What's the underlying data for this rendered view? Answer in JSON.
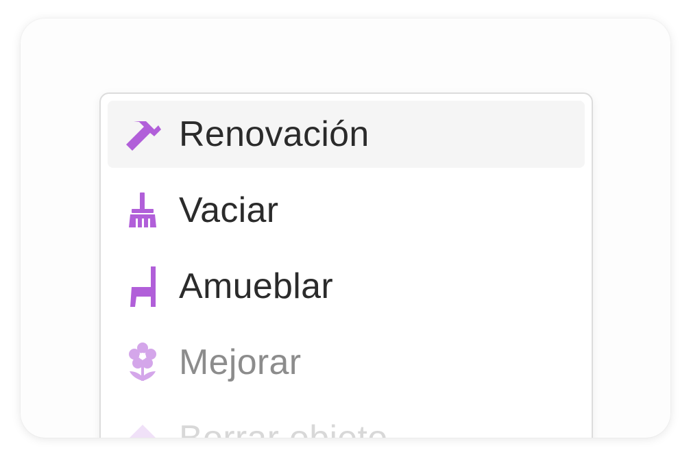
{
  "colors": {
    "accent": "#b15fd9",
    "text_primary": "#2b2b2b",
    "text_faded": "#8c8c8c",
    "highlight_bg": "#f5f5f5"
  },
  "menu": {
    "items": [
      {
        "label": "Renovación",
        "icon": "hammer-icon"
      },
      {
        "label": "Vaciar",
        "icon": "broom-icon"
      },
      {
        "label": "Amueblar",
        "icon": "chair-icon"
      },
      {
        "label": "Mejorar",
        "icon": "flower-icon"
      },
      {
        "label": "Borrar objeto",
        "icon": "eraser-icon"
      }
    ]
  }
}
